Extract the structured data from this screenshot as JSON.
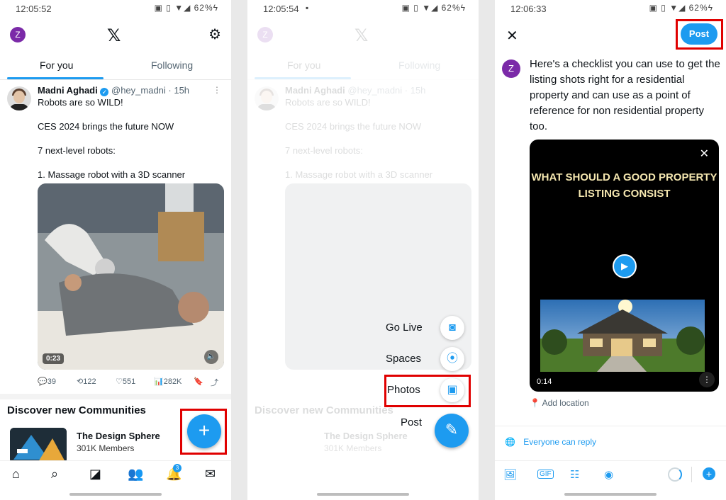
{
  "screen1": {
    "status": {
      "time": "12:05:52",
      "icons": "▣ ▯ ▼◢ 62%ϟ"
    },
    "avatar_letter": "Z",
    "logo": "𝕏",
    "tabs": [
      "For you",
      "Following"
    ],
    "post": {
      "author": "Madni Aghadi",
      "handle": "@hey_madni · 15h",
      "lines": [
        "Robots are so WILD!",
        "CES 2024 brings the future NOW",
        "7 next-level robots:",
        "1. Massage robot with a 3D scanner"
      ],
      "video_time": "0:23",
      "stats": {
        "replies": "39",
        "reposts": "122",
        "likes": "551",
        "views": "282K"
      }
    },
    "communities_title": "Discover new Communities",
    "community": {
      "name": "The Design Sphere",
      "members": "301K Members"
    },
    "notification_count": "3",
    "fab_icon": "+"
  },
  "screen2": {
    "status": {
      "time": "12:05:54",
      "icons": "▣ ▯ ▼◢ 62%ϟ"
    },
    "menu": [
      {
        "label": "Go Live",
        "icon": "live-camera-icon"
      },
      {
        "label": "Spaces",
        "icon": "spaces-icon"
      },
      {
        "label": "Photos",
        "icon": "photos-icon"
      },
      {
        "label": "Post",
        "icon": "compose-feather-icon"
      }
    ]
  },
  "screen3": {
    "status": {
      "time": "12:06:33",
      "icons": "▣ ▯ ▼◢ 62%ϟ"
    },
    "post_label": "Post",
    "avatar_letter": "Z",
    "compose_text": "Here's a checklist you can use to get the listing shots right for a residential property and can use as a point of reference for non residential property too.",
    "video_title": "WHAT SHOULD A GOOD PROPERTY LISTING CONSIST",
    "video_time": "0:14",
    "add_location": "Add location",
    "reply_setting": "Everyone can reply"
  },
  "colors": {
    "accent": "#1d9bf0",
    "highlight": "#e00000",
    "avatar": "#7b2aa8"
  }
}
